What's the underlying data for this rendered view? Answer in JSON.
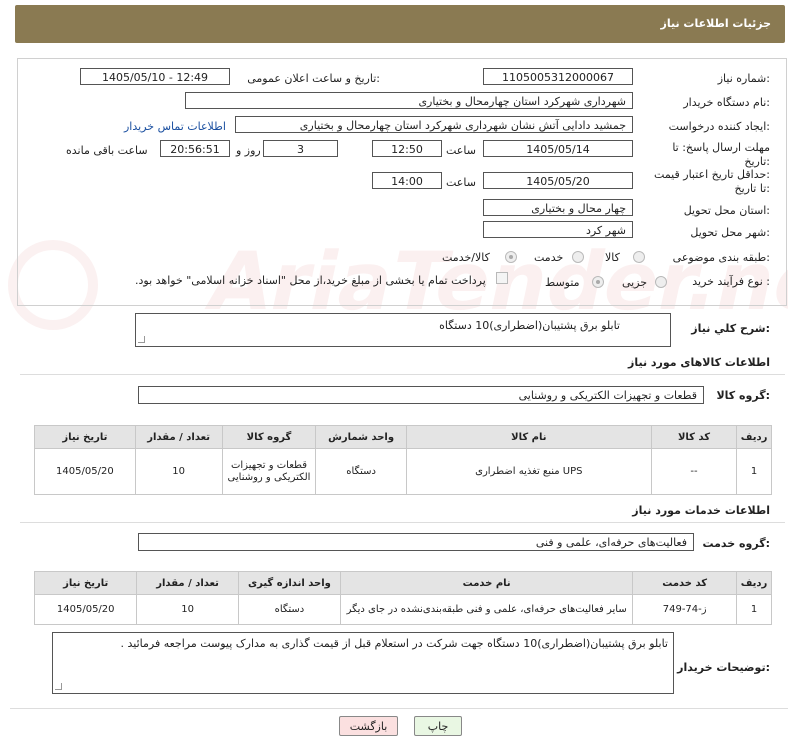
{
  "header": {
    "title": "جزئیات اطلاعات نیاز"
  },
  "watermark": "AriaTender.net",
  "form": {
    "need_number_label": "شماره نیاز:",
    "need_number": "1105005312000067",
    "announce_label": "تاریخ و ساعت اعلان عمومی:",
    "announce_value": "1405/05/10 - 12:49",
    "buyer_label": "نام دستگاه خریدار:",
    "buyer_value": "شهرداری شهرکرد استان چهارمحال و بختیاری",
    "creator_label": "ایجاد کننده درخواست:",
    "creator_value": "جمشید دادایی آتش نشان شهرداری شهرکرد استان چهارمحال و بختیاری",
    "contact_link": "اطلاعات تماس خریدار",
    "deadline_label_1": "مهلت ارسال پاسخ: تا",
    "deadline_label_2": "تاریخ:",
    "deadline_date": "1405/05/14",
    "time_label": "ساعت",
    "deadline_time": "12:50",
    "days_value": "3",
    "days_label": "روز و",
    "remaining_value": "20:56:51",
    "remaining_label": "ساعت باقی مانده",
    "validity_label_1": "حداقل تاریخ اعتبار قیمت:",
    "validity_label_2": "تا تاریخ:",
    "validity_date": "1405/05/20",
    "validity_time": "14:00",
    "province_label": "استان محل تحویل:",
    "province_value": "چهار محال و بختیاری",
    "city_label": "شهر محل تحویل:",
    "city_value": "شهر کرد",
    "category_label": "طبقه بندی موضوعی:",
    "category_options": [
      "کالا",
      "خدمت",
      "کالا/خدمت"
    ],
    "process_label": "نوع فرآیند خرید :",
    "process_options": [
      "جزیی",
      "متوسط"
    ],
    "payment_text": "پرداخت تمام یا بخشی از مبلغ خرید،از محل \"اسناد خزانه اسلامی\" خواهد بود."
  },
  "summary": {
    "label": "شرح کلي نياز:",
    "value": "تابلو برق پشتیبان(اضطراری)10 دستگاه"
  },
  "goods": {
    "section_title": "اطلاعات کالاهای مورد نیاز",
    "group_label": "گروه کالا:",
    "group_value": "قطعات و تجهیزات الکتریکی و روشنایی",
    "headers": [
      "ردیف",
      "کد کالا",
      "نام کالا",
      "واحد شمارش",
      "گروه کالا",
      "تعداد / مقدار",
      "تاریخ نیاز"
    ],
    "rows": [
      {
        "row": "1",
        "code": "--",
        "name": "منبع تغذیه اضطراری UPS",
        "unit": "دستگاه",
        "group": "قطعات و تجهیزات الکتریکی و روشنایی",
        "qty": "10",
        "date": "1405/05/20"
      }
    ]
  },
  "services": {
    "section_title": "اطلاعات خدمات مورد نیاز",
    "group_label": "گروه خدمت:",
    "group_value": "فعالیت‌های حرفه‌ای، علمی و فنی",
    "headers": [
      "ردیف",
      "کد خدمت",
      "نام خدمت",
      "واحد اندازه گیری",
      "تعداد / مقدار",
      "تاریخ نیاز"
    ],
    "rows": [
      {
        "row": "1",
        "code": "ز-74-749",
        "name": "سایر فعالیت‌های حرفه‌ای، علمی و فنی طبقه‌بندی‌نشده در جای دیگر",
        "unit": "دستگاه",
        "qty": "10",
        "date": "1405/05/20"
      }
    ]
  },
  "notes": {
    "label": "توضیحات خریدار:",
    "value": "تابلو برق پشتیبان(اضطراری)10 دستگاه جهت شرکت در استعلام قبل از قیمت گذاری به مدارک پیوست مراجعه فرمائید ."
  },
  "buttons": {
    "print": "چاپ",
    "back": "بازگشت"
  }
}
